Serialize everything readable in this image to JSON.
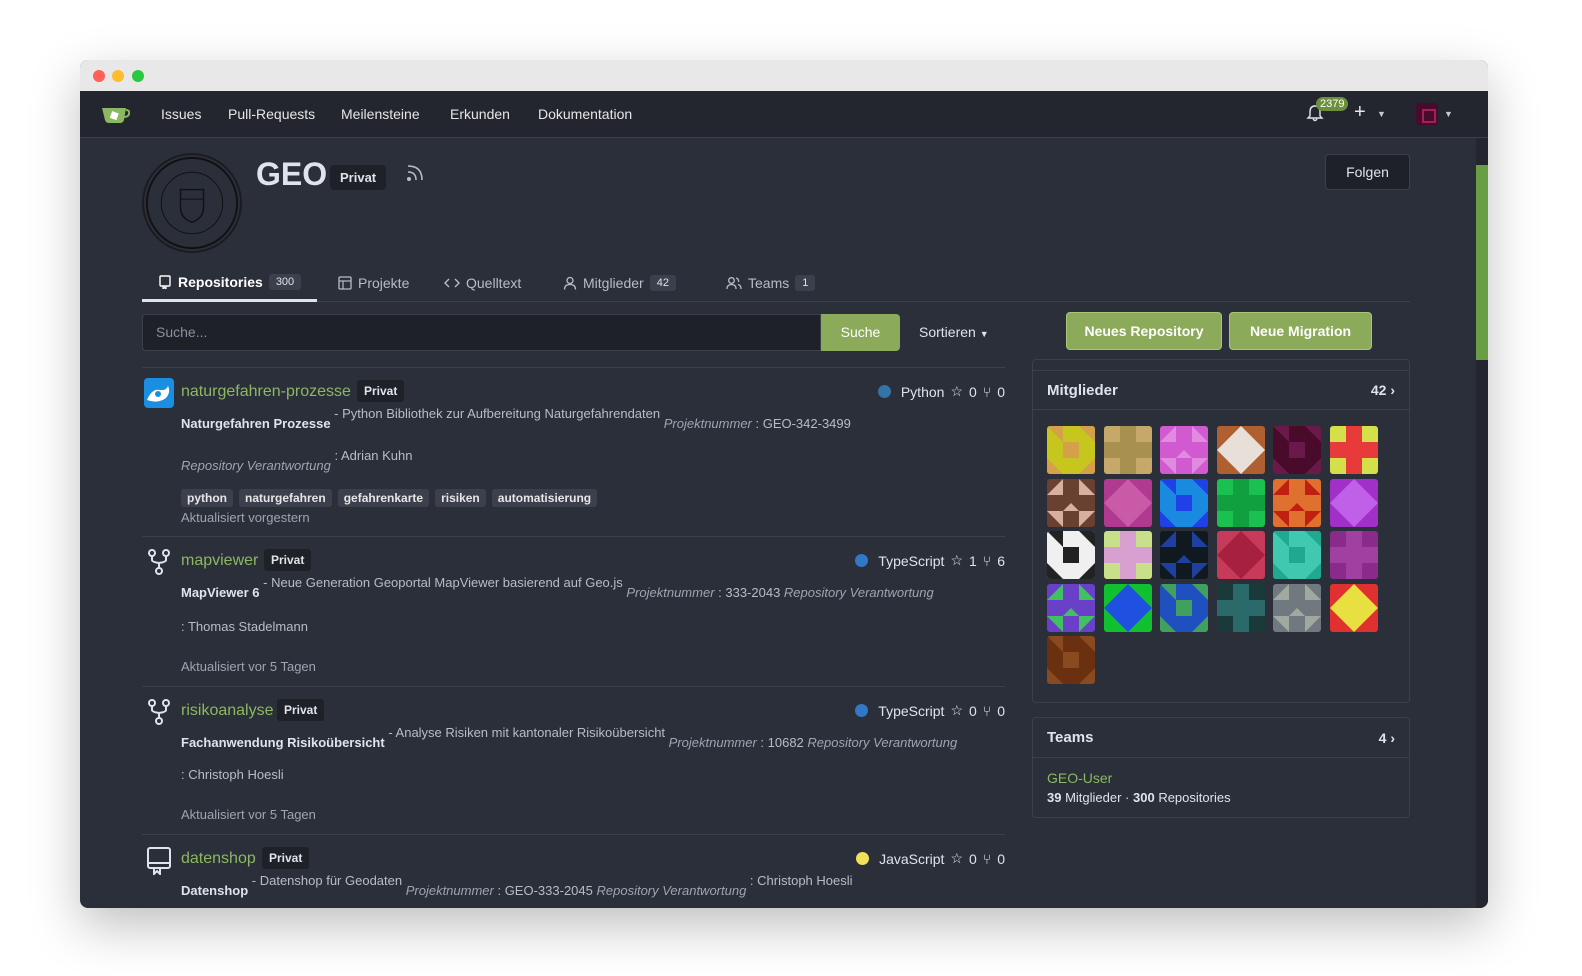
{
  "nav": {
    "items": [
      "Issues",
      "Pull-Requests",
      "Meilensteine",
      "Erkunden",
      "Dokumentation"
    ],
    "notification_count": "2379",
    "plus": "+"
  },
  "org": {
    "name": "GEO",
    "visibility": "Privat",
    "follow_label": "Folgen"
  },
  "tabs": [
    {
      "label": "Repositories",
      "count": "300",
      "icon": "repo-icon"
    },
    {
      "label": "Projekte",
      "count": "",
      "icon": "project-icon"
    },
    {
      "label": "Quelltext",
      "count": "",
      "icon": "code-icon"
    },
    {
      "label": "Mitglieder",
      "count": "42",
      "icon": "person-icon"
    },
    {
      "label": "Teams",
      "count": "1",
      "icon": "people-icon"
    }
  ],
  "search": {
    "placeholder": "Suche...",
    "button": "Suche",
    "sort": "Sortieren"
  },
  "actions": {
    "new_repo": "Neues Repository",
    "new_migration": "Neue Migration"
  },
  "repos": [
    {
      "name": "naturgefahren-prozesse",
      "visibility": "Privat",
      "language": "Python",
      "lang_color": "#3572A5",
      "stars": "0",
      "forks": "0",
      "title": "Naturgefahren Prozesse",
      "desc": " - Python Bibliothek zur Aufbereitung Naturgefahrendaten ",
      "proj_label": "Projektnummer",
      "proj_value": " : GEO-342-3499",
      "resp_label": "Repository Verantwortung",
      "resp_value": " : Adrian Kuhn",
      "topics": [
        "python",
        "naturgefahren",
        "gefahrenkarte",
        "risiken",
        "automatisierung"
      ],
      "updated": "Aktualisiert vorgestern"
    },
    {
      "name": "mapviewer",
      "visibility": "Privat",
      "language": "TypeScript",
      "lang_color": "#3178c6",
      "stars": "1",
      "forks": "6",
      "title": "MapViewer 6",
      "desc": " -  Neue Generation Geoportal MapViewer basierend auf Geo.js ",
      "proj_label": "Projektnummer",
      "proj_value": " : 333-2043 ",
      "resp_label": "Repository Verantwortung",
      "resp_value": ": Thomas Stadelmann",
      "updated": "Aktualisiert vor 5 Tagen"
    },
    {
      "name": "risikoanalyse",
      "visibility": "Privat",
      "language": "TypeScript",
      "lang_color": "#3178c6",
      "stars": "0",
      "forks": "0",
      "title": "Fachanwendung Risikoübersicht",
      "desc": "  -  Analyse Risiken mit kantonaler Risikoübersicht ",
      "proj_label": "Projektnummer",
      "proj_value": " : 10682 ",
      "resp_label": "Repository Verantwortung",
      "resp_value": ": Christoph Hoesli",
      "updated": "Aktualisiert vor 5 Tagen"
    },
    {
      "name": "datenshop",
      "visibility": "Privat",
      "language": "JavaScript",
      "lang_color": "#f1e05a",
      "stars": "0",
      "forks": "0",
      "title": "Datenshop",
      "desc": " - Datenshop für Geodaten ",
      "proj_label": "Projektnummer",
      "proj_value": " : GEO-333-2045 ",
      "resp_label": "Repository Verantwortung",
      "resp_value": " : Christoph Hoesli"
    }
  ],
  "members": {
    "title": "Mitglieder",
    "count": "42",
    "avatar_colors": [
      [
        "#c7c61f",
        "#d4a04a"
      ],
      [
        "#c6a96a",
        "#a89050"
      ],
      [
        "#d15ad1",
        "#e08ae0"
      ],
      [
        "#b06030",
        "#e8e0d8"
      ],
      [
        "#4a0a2a",
        "#6a1a4a"
      ],
      [
        "#d4e04a",
        "#e83a3a"
      ],
      [
        "#6a4030",
        "#d8b0a0"
      ],
      [
        "#b03a90",
        "#c85aa8"
      ],
      [
        "#1a8ae0",
        "#2040e8"
      ],
      [
        "#1ac050",
        "#10a040"
      ],
      [
        "#e07030",
        "#c02010"
      ],
      [
        "#a030c8",
        "#c060e8"
      ],
      [
        "#f0f0f0",
        "#222222"
      ],
      [
        "#c8e08a",
        "#d8a0d0"
      ],
      [
        "#101820",
        "#2040a0"
      ],
      [
        "#c83a5a",
        "#a82040"
      ],
      [
        "#40c8b0",
        "#20a890"
      ],
      [
        "#8a2a8a",
        "#a040a0"
      ],
      [
        "#6a40c8",
        "#40c060"
      ],
      [
        "#10c030",
        "#2050e0"
      ],
      [
        "#2050c0",
        "#40a060"
      ],
      [
        "#1a3a3a",
        "#2a6a6a"
      ],
      [
        "#707880",
        "#a0a8a0"
      ],
      [
        "#e03030",
        "#e8e040"
      ],
      [
        "#6a3010",
        "#8a4a20"
      ]
    ]
  },
  "teams": {
    "title": "Teams",
    "count": "4",
    "team_name": "GEO-User",
    "members_count": "39",
    "members_label": " Mitglieder · ",
    "repos_count": "300",
    "repos_label": " Repositories"
  }
}
